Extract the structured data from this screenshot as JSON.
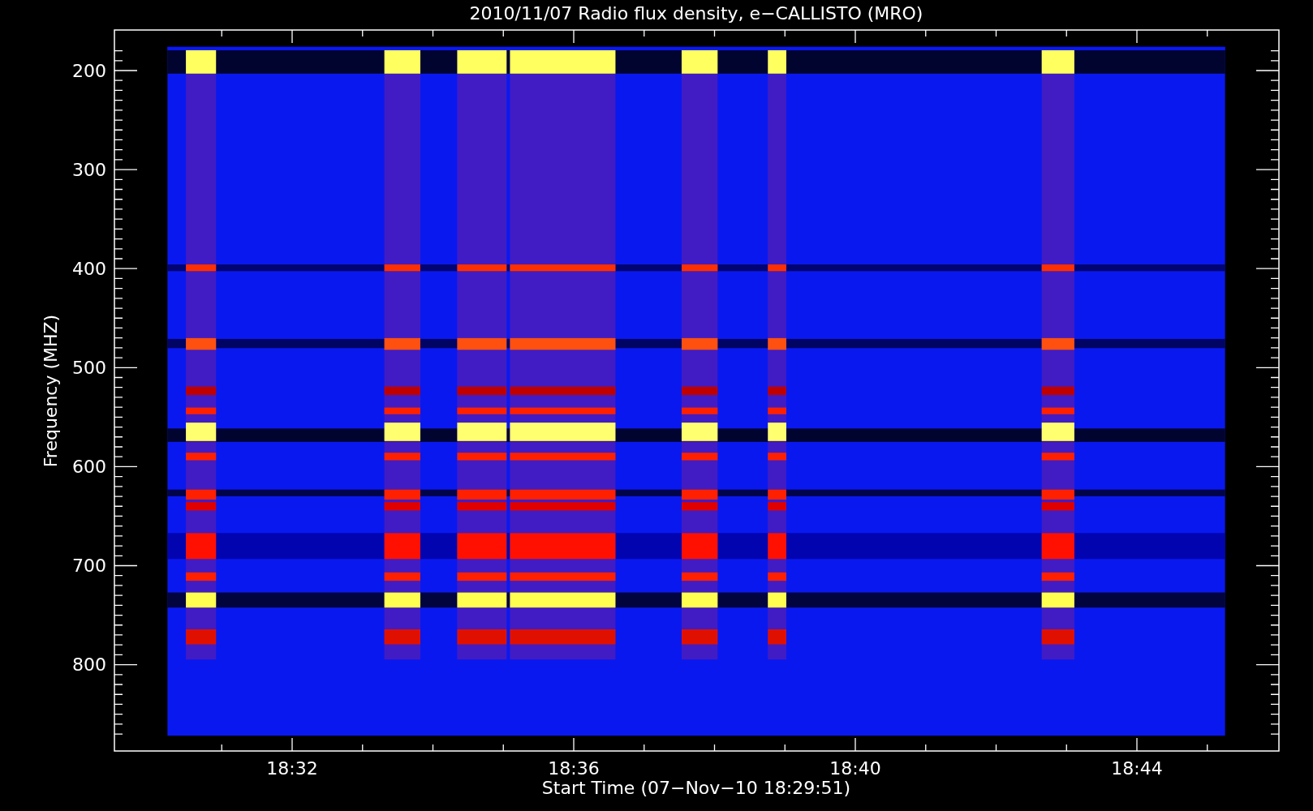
{
  "chart": {
    "title": "2010/11/07  Radio flux density, e−CALLISTO (MRO)",
    "xlabel": "Start Time (07−Nov−10 18:29:51)",
    "ylabel": "Frequency (MHZ)",
    "yticks": [
      "200",
      "300",
      "400",
      "500",
      "600",
      "700",
      "800"
    ],
    "xticks": [
      "18:32",
      "18:36",
      "18:40",
      "18:44"
    ]
  }
}
